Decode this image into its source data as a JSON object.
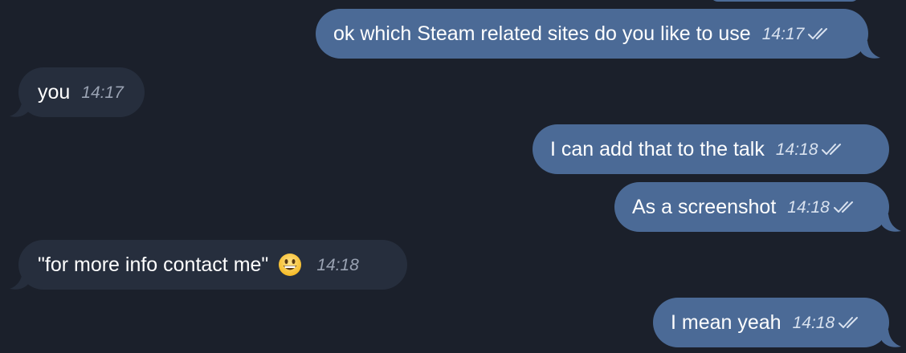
{
  "theme": {
    "background": "#1b202b",
    "outgoing_bubble": "#4b6a96",
    "incoming_bubble": "#262e3d",
    "text": "#ffffff"
  },
  "messages": [
    {
      "direction": "outgoing",
      "text": "ok which Steam related sites do you like to use",
      "time": "14:17",
      "status_icon": "double-check-icon"
    },
    {
      "direction": "incoming",
      "text": "you",
      "time": "14:17"
    },
    {
      "direction": "outgoing",
      "text": "I can add that to the talk",
      "time": "14:18",
      "status_icon": "double-check-icon"
    },
    {
      "direction": "outgoing",
      "text": "As a screenshot",
      "time": "14:18",
      "status_icon": "double-check-icon"
    },
    {
      "direction": "incoming",
      "text": "\"for more info contact me\"",
      "emoji": "grinning-face-emoji",
      "time": "14:18"
    },
    {
      "direction": "outgoing",
      "text": "I mean yeah",
      "time": "14:18",
      "status_icon": "double-check-icon"
    }
  ]
}
